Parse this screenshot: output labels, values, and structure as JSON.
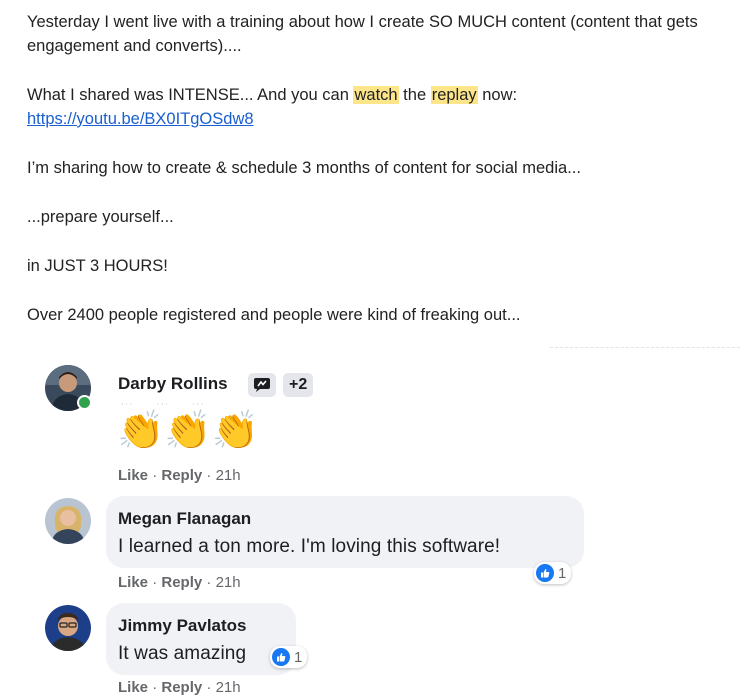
{
  "email": {
    "line1": "Yesterday I went live with a training about how I create SO MUCH content (content that gets engagement and converts)....",
    "line2_before": "What I shared was INTENSE... And you can ",
    "line2_hl1": "watch",
    "line2_mid": " the ",
    "line2_hl2": "replay",
    "line2_after": " now:",
    "link": "https://youtu.be/BX0ITgOSdw8",
    "line3": "I’m sharing how to create & schedule 3 months of content for social media...",
    "line4": "...prepare yourself...",
    "line5": "in JUST 3 HOURS!",
    "line6": "Over 2400 people registered and people were kind of freaking out..."
  },
  "comments": [
    {
      "name": "Darby Rollins",
      "extra_badges": "+2",
      "text": "👏👏👏",
      "like": "Like",
      "reply": "Reply",
      "time": "21h"
    },
    {
      "name": "Megan Flanagan",
      "text": "I learned a ton more. I'm loving this software!",
      "like": "Like",
      "reply": "Reply",
      "time": "21h",
      "reactions": "1"
    },
    {
      "name": "Jimmy Pavlatos",
      "text": "It was amazing",
      "like": "Like",
      "reply": "Reply",
      "time": "21h",
      "reactions": "1"
    }
  ],
  "separator": "·",
  "colors": {
    "highlight": "#fde68a",
    "link": "#1a5fd0",
    "bubble": "#f0f2f5",
    "like_blue": "#1877f2",
    "online_green": "#31a24c"
  }
}
